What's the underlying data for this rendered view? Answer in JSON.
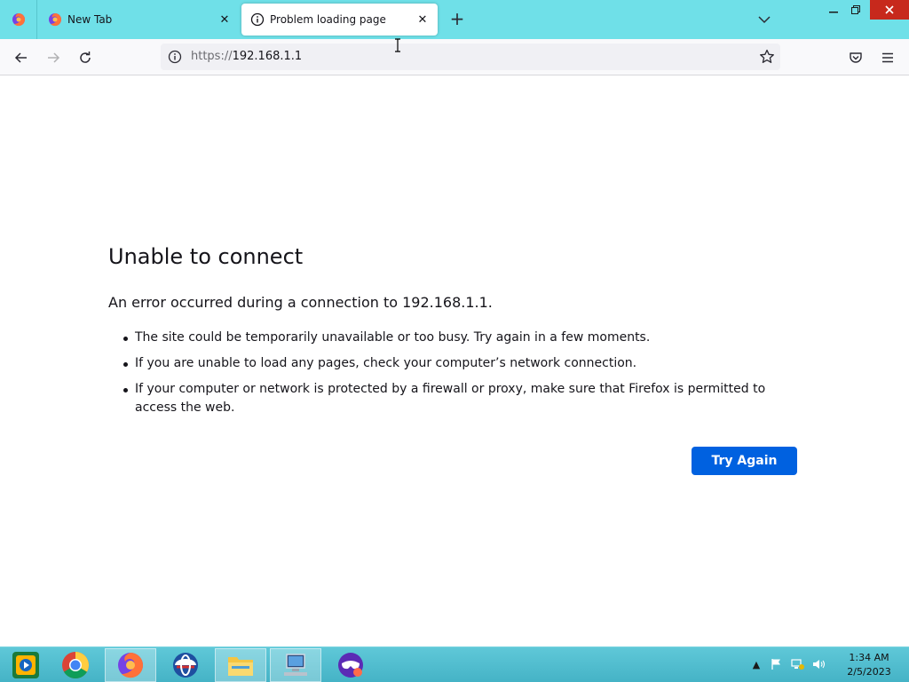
{
  "browser": {
    "tabs": [
      {
        "title": "New Tab",
        "active": false,
        "icon": "firefox-icon"
      },
      {
        "title": "Problem loading page",
        "active": true,
        "icon": "info-icon"
      }
    ],
    "url_scheme": "https://",
    "url_host": "192.168.1.1",
    "window_controls": [
      "minimize",
      "restore",
      "close"
    ]
  },
  "error_page": {
    "title": "Unable to connect",
    "intro": "An error occurred during a connection to 192.168.1.1.",
    "bullets": [
      "The site could be temporarily unavailable or too busy. Try again in a few moments.",
      "If you are unable to load any pages, check your computer’s network connection.",
      "If your computer or network is protected by a firewall or proxy, make sure that Firefox is permitted to access the web."
    ],
    "button_label": "Try Again"
  },
  "taskbar": {
    "apps": [
      "media-player-icon",
      "chrome-icon",
      "firefox-icon",
      "opera-icon",
      "file-explorer-icon",
      "network-computer-icon",
      "mask-app-icon"
    ],
    "active_app": "firefox-icon",
    "time": "1:34 AM",
    "date": "2/5/2023"
  },
  "colors": {
    "tabstrip": "#6fe0e8",
    "button": "#0061e0",
    "taskbar": "#4fbccd",
    "close_button": "#c7291c"
  }
}
